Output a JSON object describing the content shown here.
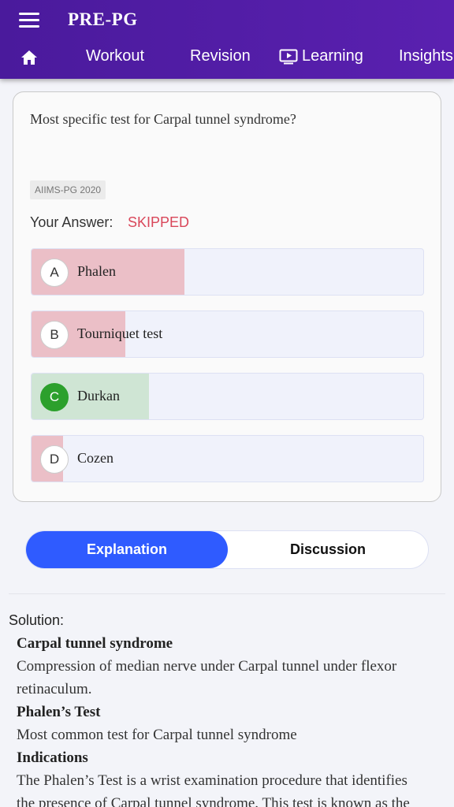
{
  "appbar": {
    "title": "PRE-PG",
    "tabs": [
      "Workout",
      "Revision",
      "Learning",
      "Insights"
    ]
  },
  "question": {
    "text": "Most specific test for Carpal tunnel syndrome?",
    "tag": "AIIMS-PG 2020",
    "your_answer_label": "Your Answer:",
    "your_answer_value": "SKIPPED",
    "options": [
      {
        "letter": "A",
        "text": "Phalen",
        "fill_fraction": 0.39,
        "correct": false
      },
      {
        "letter": "B",
        "text": "Tourniquet test",
        "fill_fraction": 0.24,
        "correct": false
      },
      {
        "letter": "C",
        "text": "Durkan",
        "fill_fraction": 0.3,
        "correct": true
      },
      {
        "letter": "D",
        "text": "Cozen",
        "fill_fraction": 0.08,
        "correct": false
      }
    ]
  },
  "toggle": {
    "explanation": "Explanation",
    "discussion": "Discussion"
  },
  "solution": {
    "label": "Solution:",
    "h1": "Carpal tunnel syndrome",
    "p1a": "Compression of median nerve under Carpal tunnel under flexor",
    "p1b": "retinaculum.",
    "h2": "Phalen’s Test",
    "p2": "Most common test for Carpal tunnel syndrome",
    "h3": "Indications",
    "p3a": "The Phalen’s Test is a wrist examination procedure that identifies",
    "p3b": "the presence of Carpal tunnel syndrome. This test is known as the"
  },
  "colors": {
    "appbar": "#4a1a9c",
    "accent": "#2f5bff",
    "wrong_fill": "#ebbfc7",
    "correct_fill": "#cfe5d4",
    "skipped": "#d9475a"
  }
}
